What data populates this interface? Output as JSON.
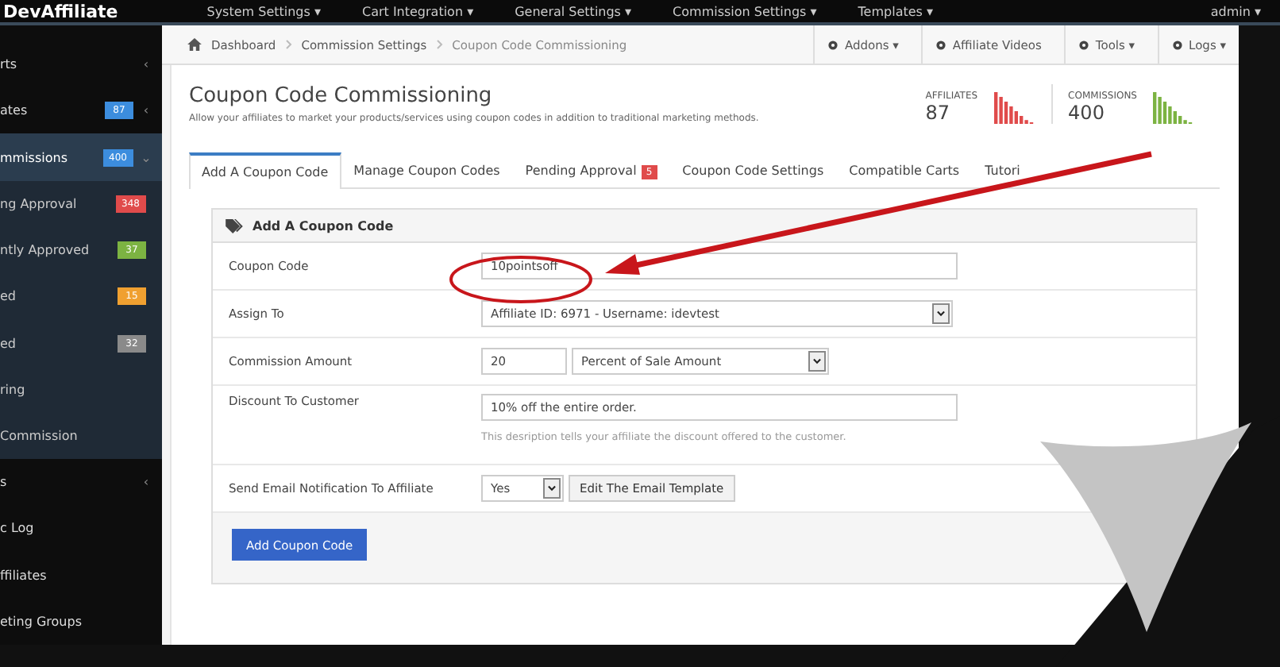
{
  "top_nav": {
    "logo": "DevAffiliate",
    "menus": [
      "System Settings ▾",
      "Cart Integration ▾",
      "General Settings ▾",
      "Commission Settings ▾",
      "Templates ▾"
    ],
    "user": "admin ▾"
  },
  "sidebar": {
    "items": [
      {
        "label": "rts",
        "caret": "‹",
        "selected": false,
        "kind": "top"
      },
      {
        "label": "ates",
        "badge": "87",
        "color": "#3c8dde",
        "caret": "‹",
        "selected": false,
        "kind": "top"
      },
      {
        "label": "mmissions",
        "badge": "400",
        "color": "#3c8dde",
        "caret": "⌄",
        "selected": true,
        "kind": "top"
      },
      {
        "label": "ng Approval",
        "badge": "348",
        "color": "#e04b4b",
        "selected": false,
        "kind": "sub"
      },
      {
        "label": "ntly Approved",
        "badge": "37",
        "color": "#7cb342",
        "selected": false,
        "kind": "sub"
      },
      {
        "label": "ed",
        "badge": "15",
        "color": "#f0a030",
        "selected": false,
        "kind": "sub"
      },
      {
        "label": "ed",
        "badge": "32",
        "color": "#8a8a8a",
        "selected": false,
        "kind": "sub"
      },
      {
        "label": "ring",
        "selected": false,
        "kind": "sub"
      },
      {
        "label": "Commission",
        "selected": false,
        "kind": "sub"
      },
      {
        "label": "s",
        "caret": "‹",
        "selected": false,
        "kind": "top"
      },
      {
        "label": "c Log",
        "selected": false,
        "kind": "top"
      },
      {
        "label": "ffiliates",
        "selected": false,
        "kind": "top"
      },
      {
        "label": "eting Groups",
        "selected": false,
        "kind": "top"
      }
    ]
  },
  "breadcrumb": [
    "Dashboard",
    "Commission Settings",
    "Coupon Code Commissioning"
  ],
  "toolbar": [
    "Addons ▾",
    "Affiliate Videos",
    "Tools ▾",
    "Logs ▾"
  ],
  "page": {
    "title": "Coupon Code Commissioning",
    "subtitle": "Allow your affiliates to market your products/services using coupon codes in addition to traditional marketing methods."
  },
  "stats": [
    {
      "label": "AFFILIATES",
      "value": "87",
      "color": "#e04b4b"
    },
    {
      "label": "COMMISSIONS",
      "value": "400",
      "color": "#7cb342"
    }
  ],
  "tabs": [
    {
      "label": "Add A Coupon Code",
      "selected": true
    },
    {
      "label": "Manage Coupon Codes",
      "selected": false
    },
    {
      "label": "Pending Approval",
      "selected": false,
      "badge": "5"
    },
    {
      "label": "Coupon Code Settings",
      "selected": false
    },
    {
      "label": "Compatible Carts",
      "selected": false
    },
    {
      "label": "Tutori",
      "selected": false
    }
  ],
  "form": {
    "title": "Add A Coupon Code",
    "coupon_code": {
      "label": "Coupon Code",
      "value": "10pointsoff"
    },
    "assign_to": {
      "label": "Assign To",
      "value": "Affiliate ID: 6971 - Username: idevtest"
    },
    "commission_amount": {
      "label": "Commission Amount",
      "value": "20",
      "type": "Percent of Sale Amount"
    },
    "discount": {
      "label": "Discount To Customer",
      "value": "10% off the entire order.",
      "help": "This desription tells your affiliate the discount offered to the customer."
    },
    "email": {
      "label": "Send Email Notification To Affiliate",
      "value": "Yes",
      "template_button": "Edit The Email Template"
    },
    "submit": "Add Coupon Code"
  }
}
